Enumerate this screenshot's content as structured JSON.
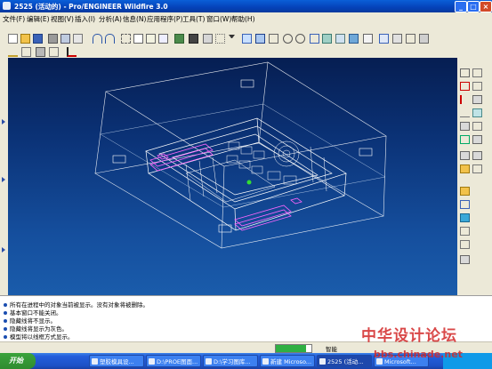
{
  "window": {
    "title": "2525 (活动的) - Pro/ENGINEER Wildfire 3.0",
    "buttons": [
      "_",
      "□",
      "×"
    ]
  },
  "menu": [
    "文件(F)",
    "编辑(E)",
    "视图(V)",
    "插入(I)",
    "分析(A)",
    "信息(N)",
    "应用程序(P)",
    "工具(T)",
    "窗口(W)",
    "帮助(H)"
  ],
  "messages": [
    "所有在进程中的对象当前被显示。没有对象将被删除。",
    "基本窗口不能关闭。",
    "隐藏线将不显示。",
    "隐藏线将显示为灰色。",
    "模型将以线框方式显示。"
  ],
  "status": {
    "progress": 0.85,
    "label": "智能"
  },
  "taskbar": {
    "start": "开始",
    "tasks": [
      "塑胶模具设...",
      "D:\\PROE图面...",
      "D:\\学习图库...",
      "新建 Microso...",
      "2525 (活动...",
      "Microsoft..."
    ]
  },
  "watermark": {
    "line1": "中华设计论坛",
    "line2": "bbs.chinade.net"
  },
  "colors": {
    "wire": "#ffffff",
    "wire_pink": "#ff66ff",
    "title_blue": "#0542b9",
    "viewport_top": "#061e52",
    "viewport_bottom": "#1a5cab"
  }
}
